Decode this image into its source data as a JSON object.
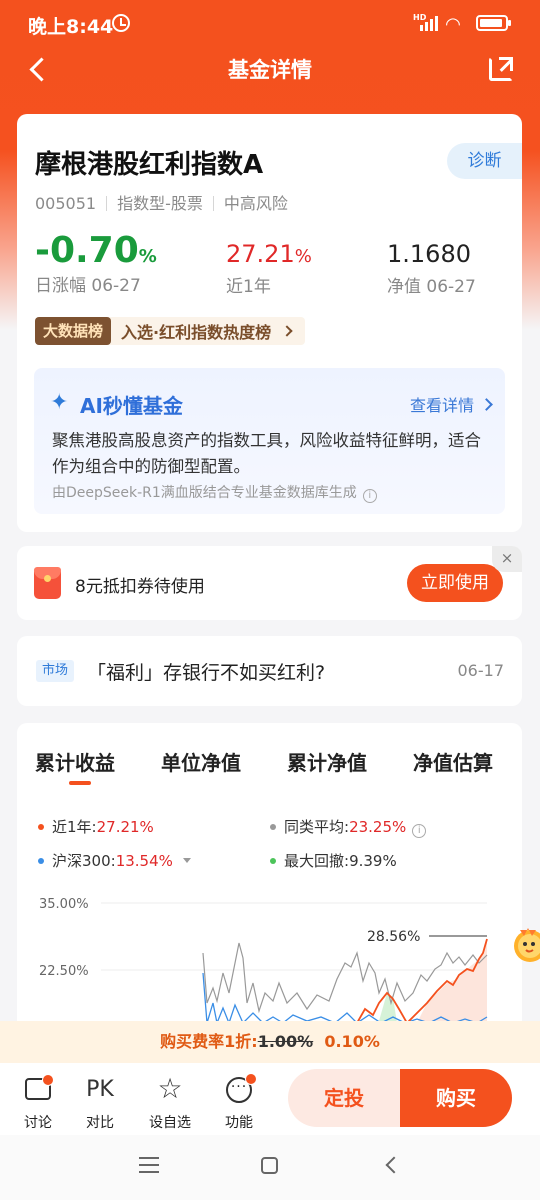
{
  "status": {
    "time": "晚上8:44",
    "network_badge": "HD"
  },
  "nav": {
    "title": "基金详情"
  },
  "fund": {
    "name": "摩根港股红利指数A",
    "diagnose_label": "诊断",
    "code": "005051",
    "type": "指数型-股票",
    "risk": "中高风险",
    "day_change_value": "-0.70",
    "day_change_unit": "%",
    "day_change_label": "日涨幅 06-27",
    "year_return_value": "27.21",
    "year_return_unit": "%",
    "year_return_label": "近1年",
    "nav_value": "1.1680",
    "nav_label": "净值 06-27",
    "bigdata_tag": "大数据榜",
    "bigdata_text": "入选·红利指数热度榜"
  },
  "ai": {
    "title": "AI秒懂基金",
    "more": "查看详情",
    "summary": "聚焦港股高股息资产的指数工具，风险收益特征鲜明，适合作为组合中的防御型配置。",
    "source": "由DeepSeek-R1满血版结合专业基金数据库生成"
  },
  "coupon": {
    "text": "8元抵扣券待使用",
    "button": "立即使用",
    "close": "×"
  },
  "news": {
    "tag": "市场",
    "title": "「福利」存银行不如买红利?",
    "date": "06-17"
  },
  "chart": {
    "tabs": [
      "累计收益",
      "单位净值",
      "累计净值",
      "净值估算"
    ],
    "legend": [
      {
        "label": "近1年:",
        "value": "27.21%",
        "color": "#f4511e"
      },
      {
        "label": "同类平均:",
        "value": "23.25%",
        "color": "#999999"
      },
      {
        "label": "沪深300:",
        "value": "13.54%",
        "color": "#3a8ee6"
      },
      {
        "label": "最大回撤:",
        "value": "9.39%",
        "color": "#4cc45a"
      }
    ],
    "peak_label": "28.56%"
  },
  "chart_data": {
    "type": "line",
    "title": "",
    "xlabel": "",
    "ylabel": "",
    "y_tick_labels": [
      "35.00%",
      "22.50%"
    ],
    "y_ticks": [
      35.0,
      22.5
    ],
    "peak_annotation": 28.56,
    "series": [
      {
        "name": "近1年",
        "final_value": 27.21
      },
      {
        "name": "同类平均",
        "final_value": 23.25
      },
      {
        "name": "沪深300",
        "final_value": 13.54
      }
    ],
    "max_drawdown": 9.39
  },
  "fee": {
    "prefix": "购买费率1折:",
    "original": "1.00%",
    "current": "0.10%"
  },
  "bottom": {
    "discuss": "讨论",
    "compare_icon": "PK",
    "compare": "对比",
    "watchlist": "设自选",
    "functions": "功能",
    "auto_invest": "定投",
    "buy": "购买"
  },
  "colors": {
    "brand": "#f4511e",
    "up": "#e02828",
    "down": "#1a9b3c",
    "link": "#2f7bd9"
  },
  "icons": [
    "back-icon",
    "share-icon",
    "sparkle-icon",
    "info-icon",
    "red-packet-icon",
    "close-icon",
    "chat-icon",
    "star-plus-icon",
    "more-icon"
  ]
}
